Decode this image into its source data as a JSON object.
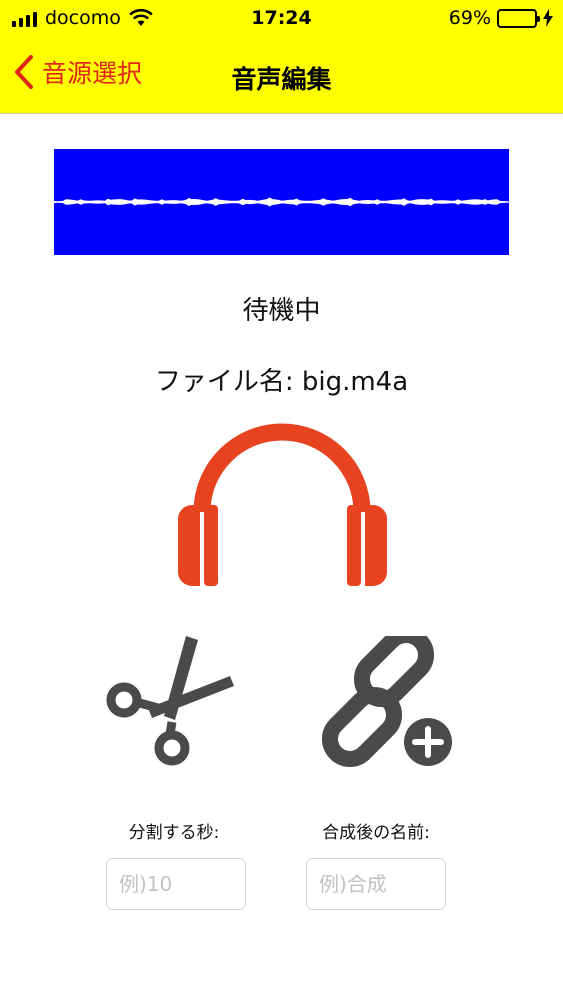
{
  "status_bar": {
    "carrier": "docomo",
    "time": "17:24",
    "battery_percent": "69%",
    "battery_level": 0.69
  },
  "nav": {
    "back_label": "音源選択",
    "title": "音声編集"
  },
  "colors": {
    "header_bg": "#ffff00",
    "accent": "#e0261b",
    "waveform_bg": "#0000ff",
    "headphones": "#e84320",
    "icon_gray": "#4a4a4a",
    "battery": "#44d84a"
  },
  "player": {
    "status": "待機中",
    "filename_label": "ファイル名: big.m4a"
  },
  "icons": {
    "play": "headphones-icon",
    "split": "scissors-icon",
    "merge": "link-add-icon"
  },
  "split": {
    "label": "分割する秒:",
    "placeholder": "例)10",
    "value": ""
  },
  "merge": {
    "label": "合成後の名前:",
    "placeholder": "例)合成",
    "value": ""
  }
}
